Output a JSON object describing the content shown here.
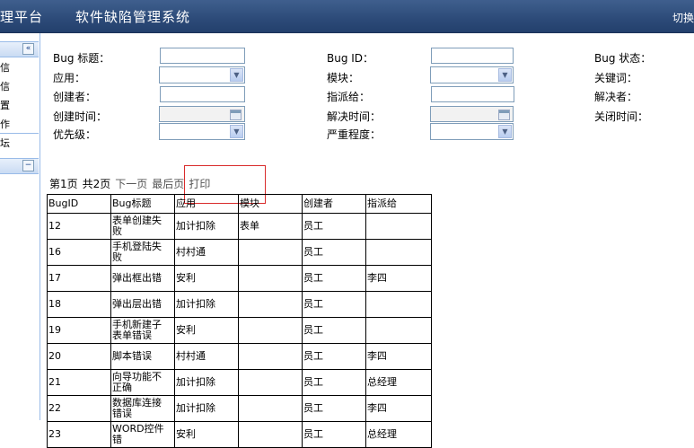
{
  "header": {
    "brand": "理平台",
    "title": "软件缺陷管理系统",
    "switch_label": "切换"
  },
  "sidebar": {
    "collapse_glyph": "«",
    "items": [
      {
        "label": "信"
      },
      {
        "label": "信"
      },
      {
        "label": "置"
      },
      {
        "label": "作"
      },
      {
        "label": "坛"
      }
    ],
    "panel2_toggle": "−"
  },
  "filters": {
    "bug_title": "Bug 标题：",
    "bug_id": "Bug ID：",
    "bug_status": "Bug 状态：",
    "app": "应用：",
    "module": "模块：",
    "keyword": "关键词：",
    "creator": "创建者：",
    "assignee": "指派给：",
    "resolver": "解决者：",
    "created_time": "创建时间：",
    "resolved_time": "解决时间：",
    "closed_time": "关闭时间：",
    "priority": "优先级：",
    "severity": "严重程度："
  },
  "pager": {
    "page": "第1页",
    "total": "共2页",
    "next": "下一页",
    "last": "最后页",
    "print": "打印"
  },
  "table": {
    "headers": [
      "BugID",
      "Bug标题",
      "应用",
      "模块",
      "创建者",
      "指派给"
    ],
    "rows": [
      [
        "12",
        "表单创建失败",
        "加计扣除",
        "表单",
        "员工",
        ""
      ],
      [
        "16",
        "手机登陆失败",
        "村村通",
        "",
        "员工",
        ""
      ],
      [
        "17",
        "弹出框出错",
        "安利",
        "",
        "员工",
        "李四"
      ],
      [
        "18",
        "弹出层出错",
        "加计扣除",
        "",
        "员工",
        ""
      ],
      [
        "19",
        "手机新建子表单错误",
        "安利",
        "",
        "员工",
        ""
      ],
      [
        "20",
        "脚本错误",
        "村村通",
        "",
        "员工",
        "李四"
      ],
      [
        "21",
        "向导功能不正确",
        "加计扣除",
        "",
        "员工",
        "总经理"
      ],
      [
        "22",
        "数据库连接错误",
        "加计扣除",
        "",
        "员工",
        "李四"
      ],
      [
        "23",
        "WORD控件错",
        "安利",
        "",
        "员工",
        "总经理"
      ]
    ]
  }
}
